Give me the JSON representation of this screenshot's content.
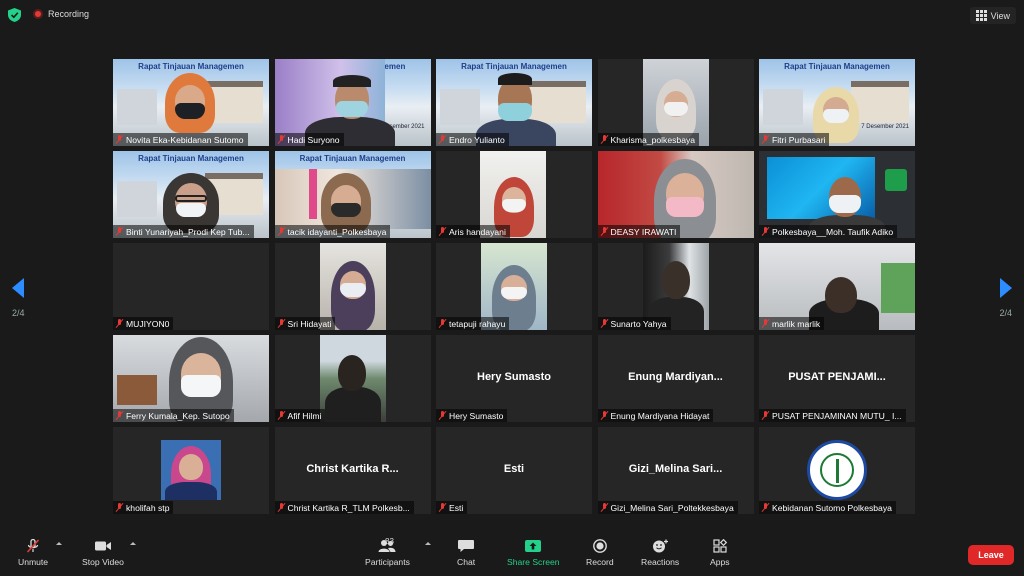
{
  "topbar": {
    "recording_label": "Recording",
    "view_label": "View"
  },
  "pager": {
    "left_label": "2/4",
    "right_label": "2/4",
    "accent": "#2d8cff"
  },
  "banner": {
    "text": "Rapat Tinjauan Managemen",
    "date": "7 Desember 2021"
  },
  "participants": [
    {
      "name": "Novita Eka-Kebidanan Sutomo"
    },
    {
      "name": "Hadi Suryono"
    },
    {
      "name": "Endro Yulianto"
    },
    {
      "name": "Kharisma_polkesbaya"
    },
    {
      "name": "Fitri Purbasari"
    },
    {
      "name": "Binti Yunariyah_Prodi Kep Tub..."
    },
    {
      "name": "tacik idayanti_Polkesbaya"
    },
    {
      "name": "Aris handayani"
    },
    {
      "name": "DEASY IRAWATI"
    },
    {
      "name": "Polkesbaya__Moh. Taufik Adiko"
    },
    {
      "name": "MUJIYON0"
    },
    {
      "name": "Sri Hidayati"
    },
    {
      "name": "tetapuji rahayu"
    },
    {
      "name": "Sunarto Yahya"
    },
    {
      "name": "marlik marlik"
    },
    {
      "name": "Ferry Kumala_Kep. Sutopo"
    },
    {
      "name": "Afif Hilmi"
    },
    {
      "name": "Hery Sumasto",
      "center": "Hery Sumasto"
    },
    {
      "name": "Enung Mardiyana Hidayat",
      "center": "Enung  Mardiyan..."
    },
    {
      "name": "PUSAT PENJAMINAN MUTU_ I...",
      "center": "PUSAT  PENJAMI..."
    },
    {
      "name": "kholifah stp"
    },
    {
      "name": "Christ Kartika R_TLM Polkesb...",
      "center": "Christ  Kartika  R..."
    },
    {
      "name": "Esti",
      "center": "Esti"
    },
    {
      "name": "Gizi_Melina Sari_Poltekkesbaya",
      "center": "Gizi_Melina  Sari..."
    },
    {
      "name": "Kebidanan Sutomo Polkesbaya"
    }
  ],
  "toolbar": {
    "unmute": "Unmute",
    "stop_video": "Stop Video",
    "participants": "Participants",
    "participants_count": "83",
    "chat": "Chat",
    "share_screen": "Share Screen",
    "record": "Record",
    "reactions": "Reactions",
    "apps": "Apps",
    "leave": "Leave",
    "leave_color": "#e02828",
    "share_color": "#23d18b"
  }
}
